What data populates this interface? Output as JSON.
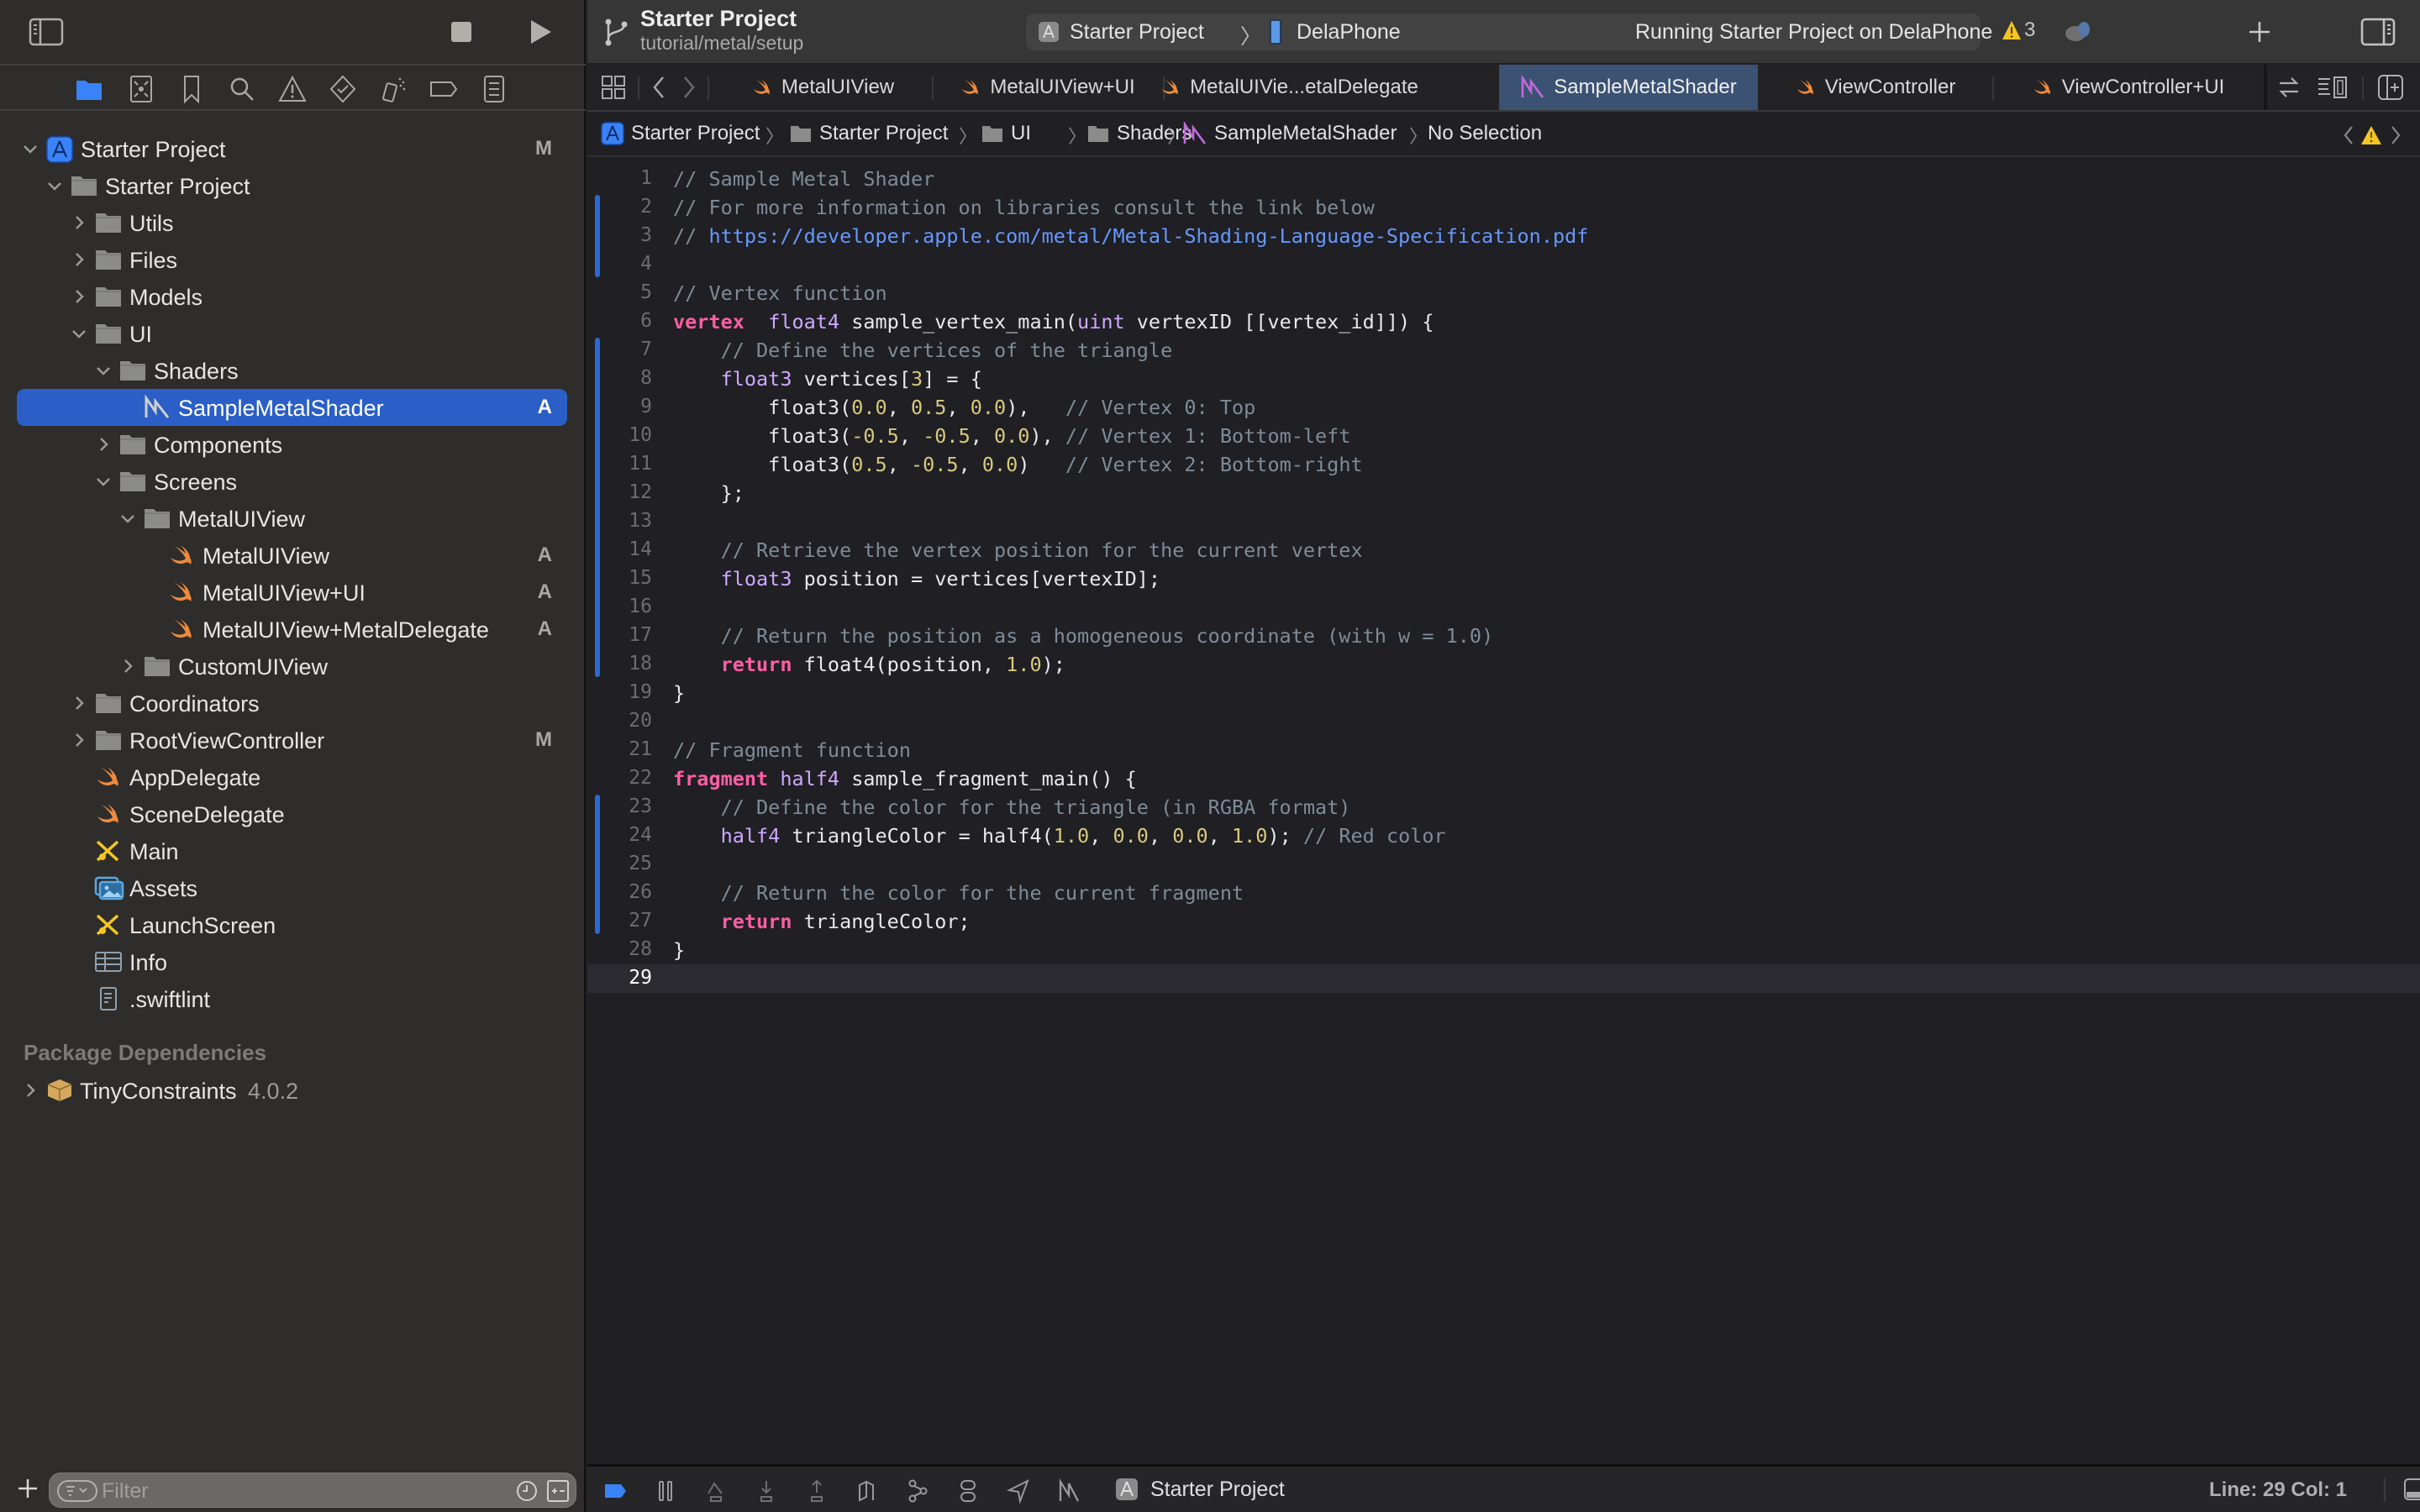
{
  "colors": {
    "selection": "#2b5fc7",
    "active_tab": "#3b5273",
    "swift_icon": "#f08a3c",
    "metal_icon": "#c06bd9",
    "warning": "#f5c623",
    "keyword": "#fc5fa3",
    "type": "#d0a8ff",
    "number": "#d9c97c",
    "comment": "#7f8c98",
    "link": "#6699ff"
  },
  "toolbar": {
    "branch_title": "Starter Project",
    "branch_name": "tutorial/metal/setup",
    "scheme_project": "Starter Project",
    "scheme_device": "DelaPhone",
    "run_status": "Running Starter Project on DelaPhone",
    "warning_count": "3",
    "icons": [
      "sidebar-toggle-icon",
      "stop-icon",
      "run-icon",
      "branch-icon",
      "add-icon",
      "inspector-toggle-icon"
    ]
  },
  "navigator_tabs": [
    "project-navigator",
    "source-control-navigator",
    "bookmark-navigator",
    "find-navigator",
    "issue-navigator",
    "test-navigator",
    "debug-navigator",
    "breakpoint-navigator",
    "report-navigator"
  ],
  "tree": [
    {
      "label": "Starter Project",
      "depth": 0,
      "icon": "project",
      "expanded": true,
      "badge": "M"
    },
    {
      "label": "Starter Project",
      "depth": 1,
      "icon": "folder",
      "expanded": true
    },
    {
      "label": "Utils",
      "depth": 2,
      "icon": "folder",
      "expanded": false
    },
    {
      "label": "Files",
      "depth": 2,
      "icon": "folder",
      "expanded": false
    },
    {
      "label": "Models",
      "depth": 2,
      "icon": "folder",
      "expanded": false
    },
    {
      "label": "UI",
      "depth": 2,
      "icon": "folder",
      "expanded": true
    },
    {
      "label": "Shaders",
      "depth": 3,
      "icon": "folder",
      "expanded": true
    },
    {
      "label": "SampleMetalShader",
      "depth": 4,
      "icon": "metal",
      "badge": "A",
      "selected": true
    },
    {
      "label": "Components",
      "depth": 3,
      "icon": "folder",
      "expanded": false
    },
    {
      "label": "Screens",
      "depth": 3,
      "icon": "folder",
      "expanded": true
    },
    {
      "label": "MetalUIView",
      "depth": 4,
      "icon": "folder",
      "expanded": true
    },
    {
      "label": "MetalUIView",
      "depth": 5,
      "icon": "swift",
      "badge": "A"
    },
    {
      "label": "MetalUIView+UI",
      "depth": 5,
      "icon": "swift",
      "badge": "A"
    },
    {
      "label": "MetalUIView+MetalDelegate",
      "depth": 5,
      "icon": "swift",
      "badge": "A"
    },
    {
      "label": "CustomUIView",
      "depth": 4,
      "icon": "folder",
      "expanded": false
    },
    {
      "label": "Coordinators",
      "depth": 2,
      "icon": "folder",
      "expanded": false
    },
    {
      "label": "RootViewController",
      "depth": 2,
      "icon": "folder",
      "expanded": false,
      "badge": "M"
    },
    {
      "label": "AppDelegate",
      "depth": 2,
      "icon": "swift"
    },
    {
      "label": "SceneDelegate",
      "depth": 2,
      "icon": "swift"
    },
    {
      "label": "Main",
      "depth": 2,
      "icon": "storyboard"
    },
    {
      "label": "Assets",
      "depth": 2,
      "icon": "assets"
    },
    {
      "label": "LaunchScreen",
      "depth": 2,
      "icon": "storyboard"
    },
    {
      "label": "Info",
      "depth": 2,
      "icon": "plist"
    },
    {
      "label": ".swiftlint",
      "depth": 2,
      "icon": "file"
    }
  ],
  "packages": {
    "header": "Package Dependencies",
    "items": [
      {
        "label": "TinyConstraints",
        "version": "4.0.2"
      }
    ]
  },
  "filter": {
    "placeholder": "Filter",
    "value": ""
  },
  "tabs": [
    {
      "label": "MetalUIView",
      "icon": "swift"
    },
    {
      "label": "MetalUIView+UI",
      "icon": "swift"
    },
    {
      "label": "MetalUIVie...etalDelegate",
      "icon": "swift"
    },
    {
      "label": "SampleMetalShader",
      "icon": "metal",
      "active": true
    },
    {
      "label": "ViewController",
      "icon": "swift"
    },
    {
      "label": "ViewController+UI",
      "icon": "swift"
    }
  ],
  "breadcrumb": [
    {
      "label": "Starter Project",
      "icon": "project"
    },
    {
      "label": "Starter Project",
      "icon": "folder"
    },
    {
      "label": "UI",
      "icon": "folder"
    },
    {
      "label": "Shaders",
      "icon": "folder"
    },
    {
      "label": "SampleMetalShader",
      "icon": "metal"
    },
    {
      "label": "No Selection",
      "icon": ""
    }
  ],
  "editor": {
    "current_line": 29,
    "lines": [
      [
        [
          "cm",
          "// Sample Metal Shader"
        ]
      ],
      [
        [
          "cm",
          "// For more information on libraries consult the link below"
        ]
      ],
      [
        [
          "cm",
          "// "
        ],
        [
          "url",
          "https://developer.apple.com/metal/Metal-Shading-Language-Specification.pdf"
        ]
      ],
      [],
      [
        [
          "cm",
          "// Vertex function"
        ]
      ],
      [
        [
          "kw",
          "vertex"
        ],
        [
          "",
          "  "
        ],
        [
          "ty",
          "float4"
        ],
        [
          "",
          " sample_vertex_main("
        ],
        [
          "ty",
          "uint"
        ],
        [
          "",
          " vertexID [[vertex_id]]) {"
        ]
      ],
      [
        [
          "",
          "    "
        ],
        [
          "cm",
          "// Define the vertices of the triangle"
        ]
      ],
      [
        [
          "",
          "    "
        ],
        [
          "ty",
          "float3"
        ],
        [
          "",
          " vertices["
        ],
        [
          "num",
          "3"
        ],
        [
          "",
          "] = {"
        ]
      ],
      [
        [
          "",
          "        float3("
        ],
        [
          "num",
          "0.0"
        ],
        [
          "",
          ", "
        ],
        [
          "num",
          "0.5"
        ],
        [
          "",
          ", "
        ],
        [
          "num",
          "0.0"
        ],
        [
          "",
          "),   "
        ],
        [
          "cm",
          "// Vertex 0: Top"
        ]
      ],
      [
        [
          "",
          "        float3("
        ],
        [
          "num",
          "-0.5"
        ],
        [
          "",
          ", "
        ],
        [
          "num",
          "-0.5"
        ],
        [
          "",
          ", "
        ],
        [
          "num",
          "0.0"
        ],
        [
          "",
          "), "
        ],
        [
          "cm",
          "// Vertex 1: Bottom-left"
        ]
      ],
      [
        [
          "",
          "        float3("
        ],
        [
          "num",
          "0.5"
        ],
        [
          "",
          ", "
        ],
        [
          "num",
          "-0.5"
        ],
        [
          "",
          ", "
        ],
        [
          "num",
          "0.0"
        ],
        [
          "",
          ")   "
        ],
        [
          "cm",
          "// Vertex 2: Bottom-right"
        ]
      ],
      [
        [
          "",
          "    };"
        ]
      ],
      [],
      [
        [
          "",
          "    "
        ],
        [
          "cm",
          "// Retrieve the vertex position for the current vertex"
        ]
      ],
      [
        [
          "",
          "    "
        ],
        [
          "ty",
          "float3"
        ],
        [
          "",
          " position = vertices[vertexID];"
        ]
      ],
      [],
      [
        [
          "",
          "    "
        ],
        [
          "cm",
          "// Return the position as a homogeneous coordinate (with w = 1.0)"
        ]
      ],
      [
        [
          "",
          "    "
        ],
        [
          "kw",
          "return"
        ],
        [
          "",
          " float4(position, "
        ],
        [
          "num",
          "1.0"
        ],
        [
          "",
          ");"
        ]
      ],
      [
        [
          "",
          "}"
        ]
      ],
      [],
      [
        [
          "cm",
          "// Fragment function"
        ]
      ],
      [
        [
          "kw",
          "fragment"
        ],
        [
          "",
          " "
        ],
        [
          "ty",
          "half4"
        ],
        [
          "",
          " sample_fragment_main() {"
        ]
      ],
      [
        [
          "",
          "    "
        ],
        [
          "cm",
          "// Define the color for the triangle (in RGBA format)"
        ]
      ],
      [
        [
          "",
          "    "
        ],
        [
          "ty",
          "half4"
        ],
        [
          "",
          " triangleColor = half4("
        ],
        [
          "num",
          "1.0"
        ],
        [
          "",
          ", "
        ],
        [
          "num",
          "0.0"
        ],
        [
          "",
          ", "
        ],
        [
          "num",
          "0.0"
        ],
        [
          "",
          ", "
        ],
        [
          "num",
          "1.0"
        ],
        [
          "",
          "); "
        ],
        [
          "cm",
          "// Red color"
        ]
      ],
      [],
      [
        [
          "",
          "    "
        ],
        [
          "cm",
          "// Return the color for the current fragment"
        ]
      ],
      [
        [
          "",
          "    "
        ],
        [
          "kw",
          "return"
        ],
        [
          "",
          " triangleColor;"
        ]
      ],
      [
        [
          "",
          "}"
        ]
      ],
      []
    ],
    "change_bars": [
      [
        2,
        4
      ],
      [
        7,
        18
      ],
      [
        23,
        27
      ]
    ]
  },
  "statusbar": {
    "target": "Starter Project",
    "line": "Line: 29",
    "col": "Col: 1",
    "position_text": "Line: 29  Col: 1"
  }
}
